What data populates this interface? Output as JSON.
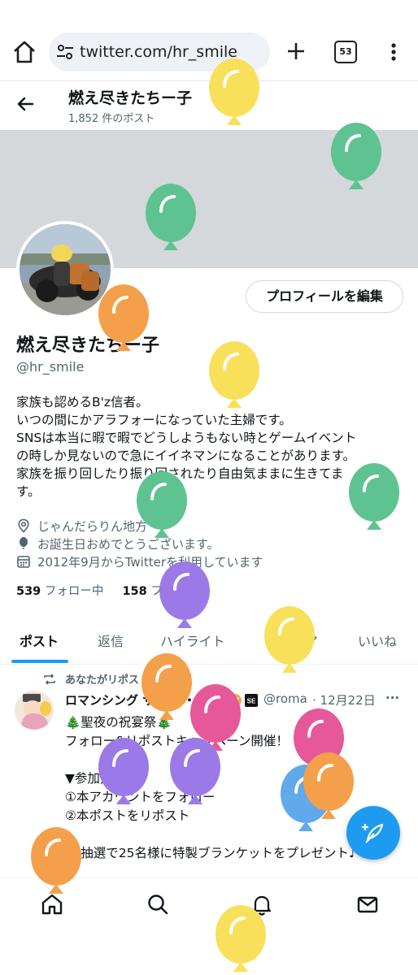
{
  "browser": {
    "url": "twitter.com/hr_smile",
    "tab_count": "53",
    "icons": [
      "home-icon",
      "site-settings-icon",
      "plus-icon",
      "tab-switcher-icon",
      "more-vertical-icon"
    ]
  },
  "header": {
    "name": "燃え尽きたちー子",
    "post_count": "1,852 件のポスト"
  },
  "profile": {
    "edit_button": "プロフィールを編集",
    "display_name": "燃え尽きたちー子",
    "handle": "@hr_smile",
    "bio_lines": [
      "家族も認めるB'z信者。",
      "いつの間にかアラフォーになっていた主婦です。",
      "SNSは本当に暇で暇でどうしようもない時とゲームイベント",
      "の時しか見ないので急にイイネマンになることがあります。",
      "家族を振り回したり振り回されたり自由気ままに生きてま",
      "す。"
    ],
    "location": "じゃんだらりん地方",
    "birthday": "お誕生日おめでとうございます。",
    "joined": "2012年9月からTwitterを利用しています",
    "following_count": "539",
    "following_label": "フォロー中",
    "followers_count": "158",
    "followers_label": "フォロワー"
  },
  "tabs": [
    {
      "label": "ポスト",
      "active": true
    },
    {
      "label": "返信",
      "active": false
    },
    {
      "label": "ハイライト",
      "active": false
    },
    {
      "label": "メディア",
      "active": false
    },
    {
      "label": "いいね",
      "active": false
    }
  ],
  "post": {
    "repost_note": "あなたがリポストしました",
    "author": "ロマンシング サガ リ・ユ",
    "handle": "@roma",
    "date": "· 12月22日",
    "more": "···",
    "body_lines": [
      "🎄聖夜の祝宴祭🎄",
      "フォロー&リポストキャンペーン開催！",
      "",
      "▼参加方法",
      "①本アカウントをフォロー",
      "②本ポストをリポスト",
      "",
      "🎁抽選で25名様に特製ブランケットをプレゼント♪"
    ]
  },
  "bottom_nav": [
    "home-icon",
    "search-icon",
    "notifications-icon",
    "messages-icon"
  ],
  "balloon_colors": {
    "yellow": "#f9e05b",
    "green": "#5fc391",
    "orange": "#f4a04a",
    "purple": "#9b7ae8",
    "pink": "#e7589a",
    "blue": "#5fa9ec"
  },
  "accent_color": "#1d9bf0"
}
